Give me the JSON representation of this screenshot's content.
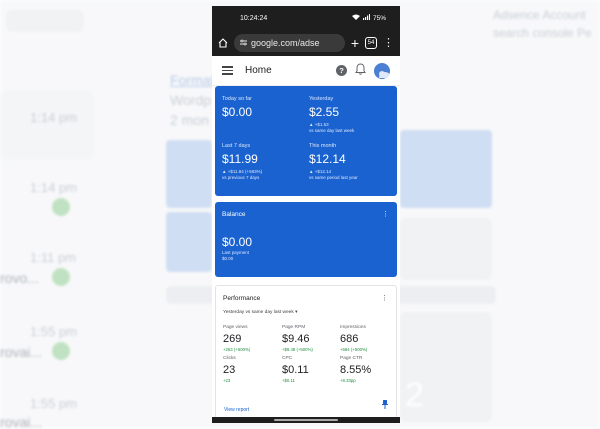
{
  "background": {
    "top_right_line1": "Adsence Account",
    "top_right_line2": "search console Pe",
    "left_title_line1": "Format",
    "left_title_line2": "Wordp",
    "left_title_line3": "2 mon",
    "times": [
      "1:14 pm",
      "1:11 pm",
      "1:55 pm",
      "1:55 pm"
    ],
    "left_words": [
      "rovo...",
      "rovai...",
      "rovai..."
    ],
    "big_number": "2"
  },
  "status_bar": {
    "time": "10:24:24",
    "battery": "75%"
  },
  "browser": {
    "url": "google.com/adse",
    "tab_count": "54"
  },
  "app_bar": {
    "title": "Home"
  },
  "earnings": {
    "today_label": "Today so far",
    "today_value": "$0.00",
    "yesterday_label": "Yesterday",
    "yesterday_value": "$2.55",
    "yesterday_delta": "▲ +$1.53",
    "yesterday_compare": "vs same day last week",
    "last7_label": "Last 7 days",
    "last7_value": "$11.99",
    "last7_delta": "▲ +$11.84 (+583%)",
    "last7_compare": "vs previous 7 days",
    "month_label": "This month",
    "month_value": "$12.14",
    "month_delta": "▲ +$12.14",
    "month_compare": "vs same period last year"
  },
  "balance": {
    "title": "Balance",
    "value": "$0.00",
    "last_payment_label": "Last payment",
    "last_payment_value": "$0.00"
  },
  "performance": {
    "title": "Performance",
    "range": "Yesterday vs same day last week",
    "metrics": [
      {
        "label": "Page views",
        "value": "269",
        "delta": "+263 (+500%)"
      },
      {
        "label": "Page RPM",
        "value": "$9.46",
        "delta": "+$9.48 (+500%)"
      },
      {
        "label": "Impressions",
        "value": "686",
        "delta": "+684 (+500%)"
      },
      {
        "label": "Clicks",
        "value": "23",
        "delta": "+23"
      },
      {
        "label": "CPC",
        "value": "$0.11",
        "delta": "+$0.11"
      },
      {
        "label": "Page CTR",
        "value": "8.55%",
        "delta": "+8.33pp"
      }
    ],
    "view_report": "View report"
  },
  "colors": {
    "brand_blue": "#1a62cf",
    "positive_green": "#1e8e3e",
    "browser_dark": "#1e1e1e"
  }
}
